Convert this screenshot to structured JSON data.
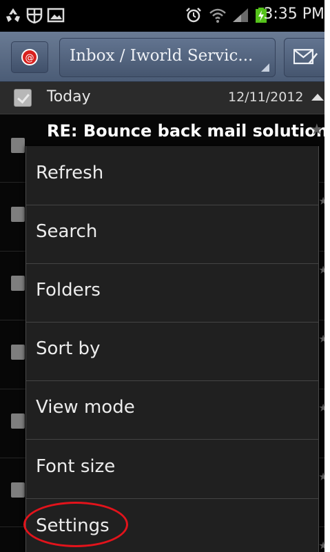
{
  "status_bar": {
    "time": "3:35 PM",
    "icons": [
      "recycle-icon",
      "shield-icon",
      "image-icon",
      "alarm-icon",
      "wifi-icon",
      "signal-icon",
      "battery-charging-icon"
    ]
  },
  "header": {
    "account_dropdown": "Inbox / Iworld Servic...",
    "compose_icon": "compose-mail-icon",
    "account_icon": "mail-at-icon"
  },
  "today_bar": {
    "label": "Today",
    "date": "12/11/2012"
  },
  "mail_list": {
    "first_subject": "RE: Bounce back mail solution"
  },
  "menu": {
    "items": [
      {
        "label": "Refresh"
      },
      {
        "label": "Search"
      },
      {
        "label": "Folders"
      },
      {
        "label": "Sort by"
      },
      {
        "label": "View mode"
      },
      {
        "label": "Font size"
      },
      {
        "label": "Settings",
        "highlighted": true
      }
    ]
  },
  "colors": {
    "header": "#56667f",
    "menu_bg": "#202020",
    "highlight_circle": "#e2131b"
  }
}
